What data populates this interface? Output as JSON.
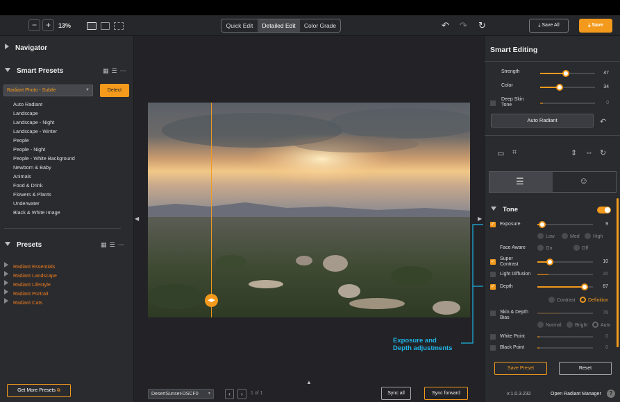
{
  "toolbar": {
    "zoom_out": "−",
    "zoom_in": "+",
    "zoom_level": "13%",
    "modes": [
      "Quick Edit",
      "Detailed Edit",
      "Color Grade"
    ],
    "active_mode": "Detailed Edit",
    "save_all": "⤓ Save All",
    "save": "⤓ Save"
  },
  "left": {
    "navigator": "Navigator",
    "smart_presets": "Smart Presets",
    "selected_preset": "Radiant Photo - Subtle",
    "detect": "Detect",
    "preset_items": [
      "Auto Radiant",
      "Landscape",
      "Landscape - Night",
      "Landscape - Winter",
      "People",
      "People - Night",
      "People - White Background",
      "Newborn & Baby",
      "Animals",
      "Food & Drink",
      "Flowers & Plants",
      "Underwater",
      "Black & White Image"
    ],
    "presets": "Presets",
    "preset_groups": [
      "Radiant Essentials",
      "Radiant Landscape",
      "Radiant Lifestyle",
      "Radiant Portrait",
      "Radiant Cats"
    ],
    "get_more": "Get More Presets"
  },
  "center": {
    "filename": "DesertSunset-DSCF0",
    "page_info": "1 of 1",
    "sync_all": "Sync all",
    "sync_forward": "Sync forward",
    "annotation_line1": "Exposure and",
    "annotation_line2": "Depth adjustments"
  },
  "right": {
    "title": "Smart Editing",
    "strength": {
      "label": "Strength",
      "value": "47",
      "level": 0.47
    },
    "color": {
      "label": "Color",
      "value": "34",
      "level": 0.34
    },
    "deep_skin_line1": "Deep Skin",
    "deep_skin_line2": "Tone",
    "deep_skin_value": "0",
    "auto_radiant": "Auto Radiant",
    "tone": "Tone",
    "exposure": {
      "label": "Exposure",
      "value": "9",
      "level": 0.09
    },
    "exposure_opts": [
      "Low",
      "Med",
      "High"
    ],
    "face_aware": "Face Aware",
    "face_opts": [
      "On",
      "Off"
    ],
    "super_contrast_line1": "Super",
    "super_contrast_line2": "Contrast",
    "super_contrast": {
      "value": "10",
      "level": 0.2
    },
    "light_diffusion": {
      "label": "Light Diffusion",
      "value": "20"
    },
    "depth": {
      "label": "Depth",
      "value": "87",
      "level": 0.87
    },
    "depth_opts": [
      "Contrast",
      "Definition"
    ],
    "skin_depth_line1": "Skin & Depth",
    "skin_depth_line2": "Bias",
    "skin_depth_value": "76",
    "bias_opts": [
      "Normal",
      "Bright",
      "Auto"
    ],
    "white_point": {
      "label": "White Point",
      "value": "0"
    },
    "black_point": {
      "label": "Black Point",
      "value": "0"
    },
    "save_preset": "Save Preset",
    "reset": "Reset",
    "version": "v:1.0.3.232",
    "open_manager": "Open Radiant Manager",
    "help": "?"
  },
  "colors": {
    "accent": "#f39a1c",
    "annotation": "#1fb4e6",
    "preset_group": "#f07e1e"
  }
}
